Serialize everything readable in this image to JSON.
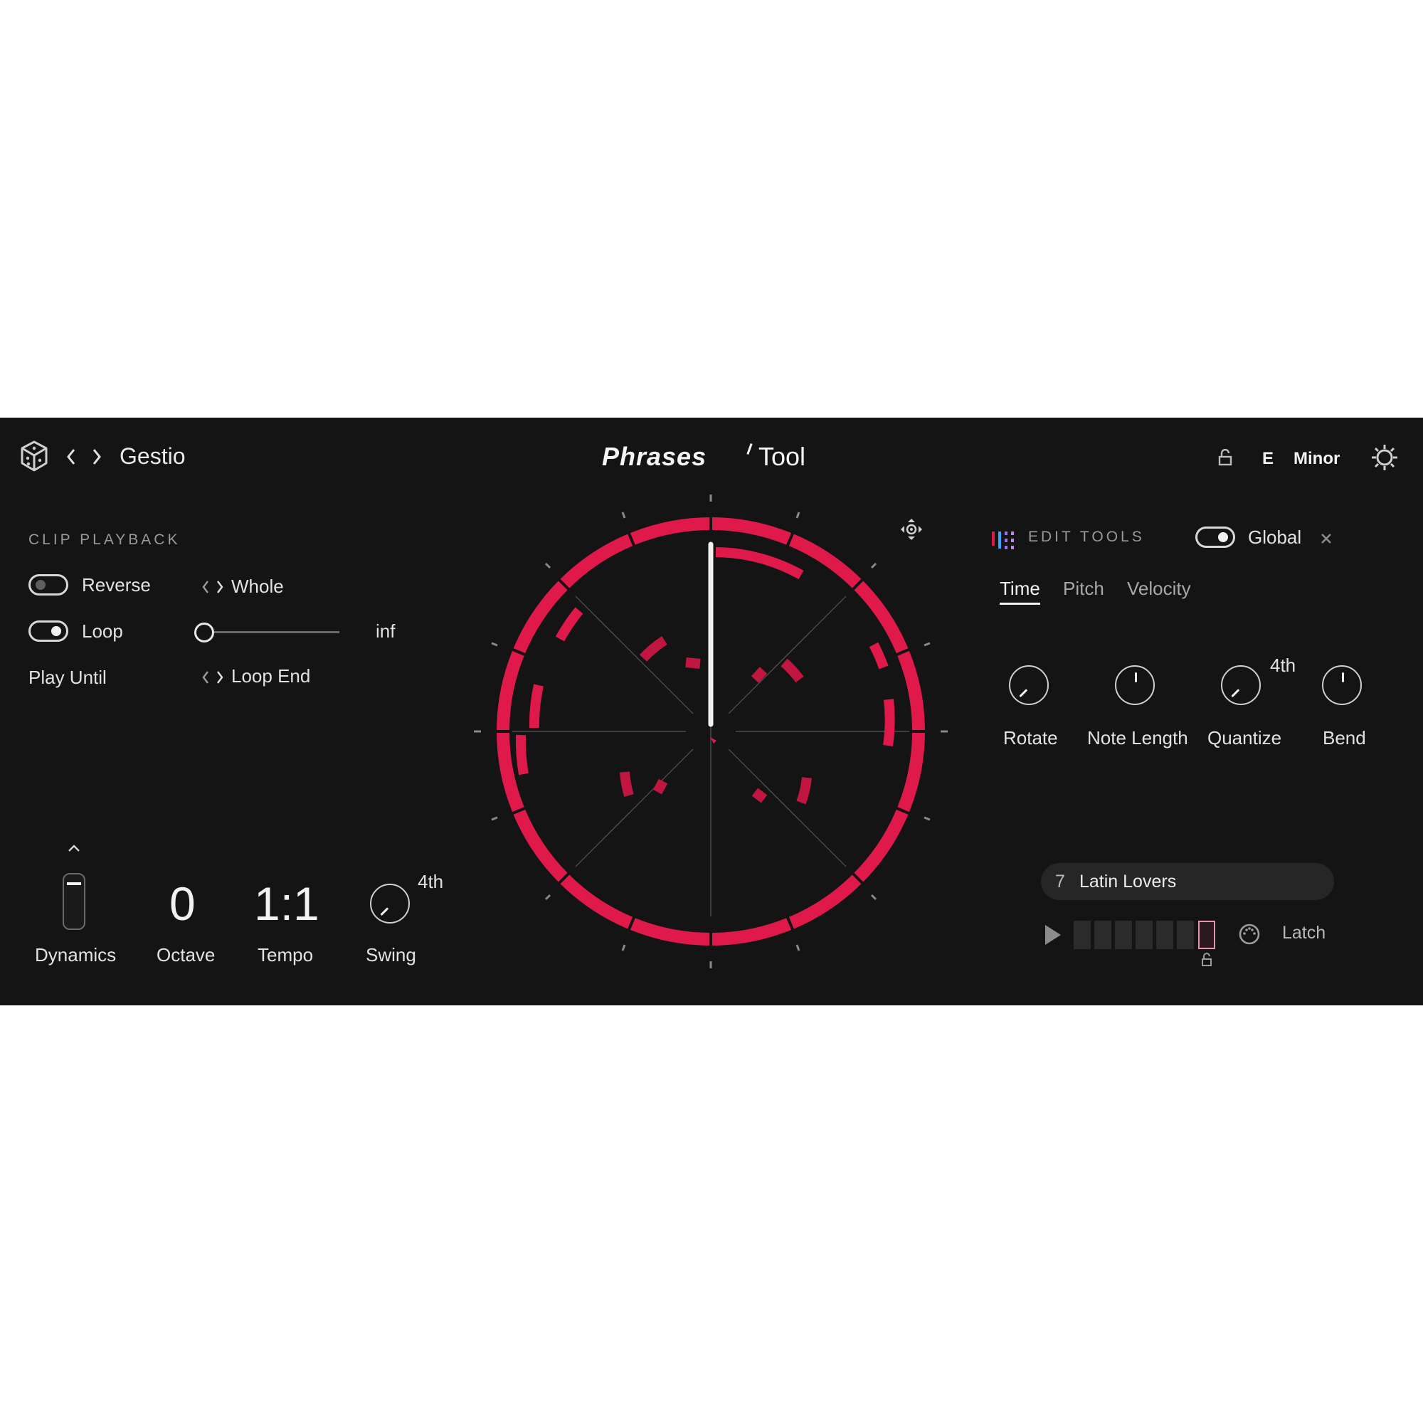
{
  "header": {
    "app_name": "Gestio",
    "logo_word": "Phrases",
    "logo_sub": "Tool",
    "key_root": "E",
    "key_scale": "Minor",
    "icons": [
      "dice-icon",
      "chevron-left-icon",
      "chevron-right-icon",
      "lock-icon",
      "gear-icon"
    ]
  },
  "clip_playback": {
    "title": "CLIP PLAYBACK",
    "reverse_label": "Reverse",
    "reverse_on": false,
    "loop_label": "Loop",
    "loop_on": true,
    "play_until_label": "Play Until",
    "whole_label": "Whole",
    "loop_slider_value": 0,
    "loop_value_label": "inf",
    "loop_end_label": "Loop End"
  },
  "bottom_controls": {
    "dynamics_label": "Dynamics",
    "octave_value": "0",
    "octave_label": "Octave",
    "tempo_value": "1:1",
    "tempo_label": "Tempo",
    "swing_value": "4th",
    "swing_label": "Swing"
  },
  "edit_tools": {
    "title": "EDIT TOOLS",
    "global_label": "Global",
    "global_on": true,
    "tabs": [
      "Time",
      "Pitch",
      "Velocity"
    ],
    "active_tab": "Time",
    "knobs": [
      {
        "label": "Rotate",
        "value": ""
      },
      {
        "label": "Note Length",
        "value": ""
      },
      {
        "label": "Quantize",
        "value": "4th"
      },
      {
        "label": "Bend",
        "value": ""
      }
    ]
  },
  "phrase": {
    "number": "7",
    "name": "Latin Lovers",
    "latch_label": "Latch",
    "steps_total": 7,
    "active_step": 7
  },
  "colors": {
    "accent": "#e0194b",
    "panel_bg": "#141414"
  }
}
